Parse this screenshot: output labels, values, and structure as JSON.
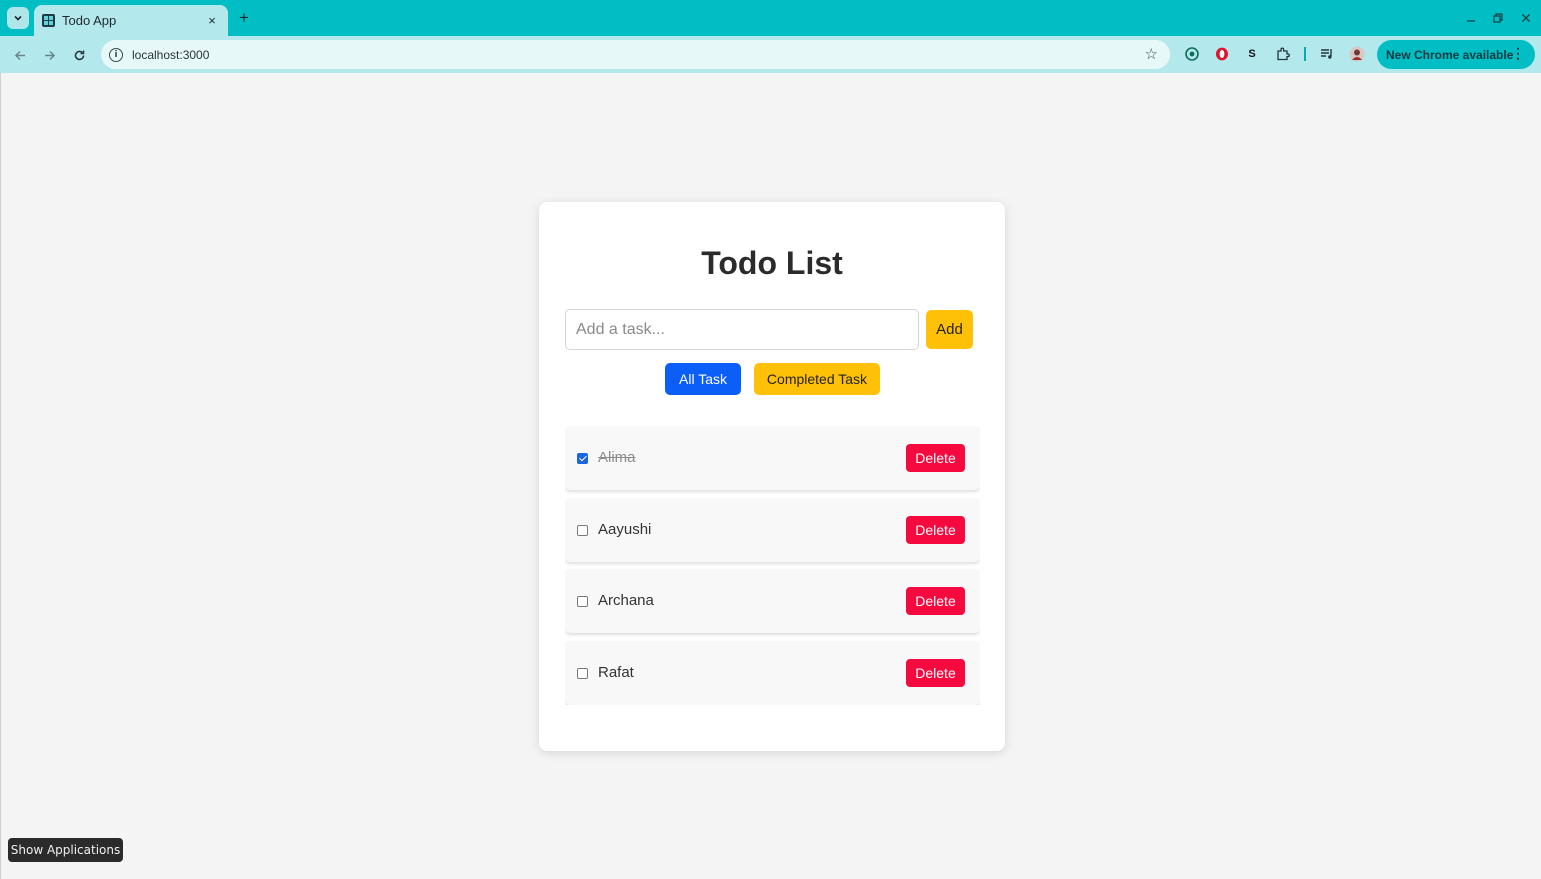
{
  "browser": {
    "tab_title": "Todo App",
    "tab_close": "×",
    "new_tab": "+",
    "url": "localhost:3000",
    "update_chip_label": "New Chrome available",
    "icons": [
      "tab-search-icon",
      "favicon-icon",
      "back-icon",
      "forward-icon",
      "reload-icon",
      "site-info-icon",
      "star-icon",
      "extension-icons",
      "puzzle-icon",
      "media-icon",
      "profile-icon",
      "kebab-menu-icon"
    ],
    "tab_strip_color": "#00bec4",
    "toolbar_color": "#b3e8ec"
  },
  "app": {
    "title": "Todo List",
    "input": {
      "placeholder": "Add a task...",
      "value": ""
    },
    "add_label": "Add",
    "filters": {
      "all_label": "All Task",
      "completed_label": "Completed Task"
    },
    "delete_label": "Delete",
    "tasks": [
      {
        "text": "Alima",
        "completed": true
      },
      {
        "text": "Aayushi",
        "completed": false
      },
      {
        "text": "Archana",
        "completed": false
      },
      {
        "text": "Rafat",
        "completed": false
      }
    ],
    "colors": {
      "primary_blue": "#0b5ef7",
      "accent_yellow": "#ffc107",
      "delete_red": "#f5093f"
    }
  },
  "desktop": {
    "show_apps_tooltip": "Show Applications"
  }
}
